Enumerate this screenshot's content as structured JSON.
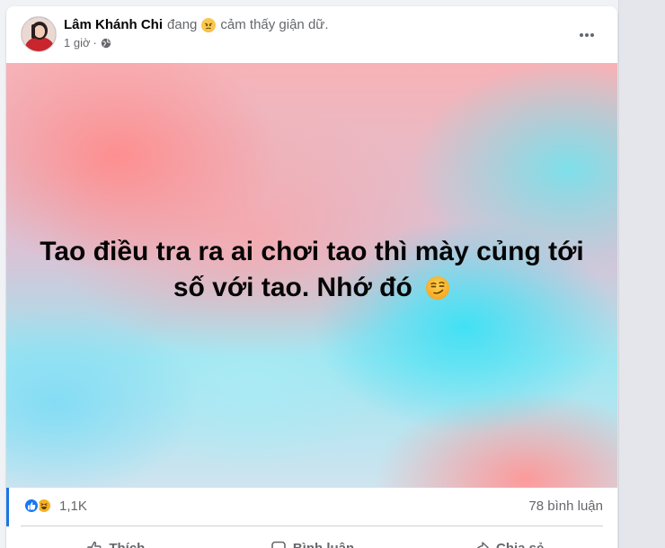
{
  "post": {
    "author_name": "Lâm Khánh Chi",
    "feeling_prefix": "đang",
    "feeling_emoji": "angry-face-icon",
    "feeling_text": "cảm thấy giận dữ.",
    "time": "1 giờ",
    "separator": "·",
    "privacy_icon": "globe-icon",
    "body_lines": [
      "Tao điều tra ra ai chơi tao thì mày củng tới",
      "số với tao. Nhớ đó"
    ],
    "body_emoji": "smirking-face-icon"
  },
  "stats": {
    "reaction_icons": [
      "like-icon",
      "haha-icon"
    ],
    "reaction_count": "1,1K",
    "comment_count": "78 bình luận"
  },
  "actions": {
    "like_label": "Thích",
    "comment_label": "Bình luận",
    "share_label": "Chia sẻ"
  },
  "colors": {
    "accent": "#1877f2",
    "text_primary": "#050505",
    "text_secondary": "#65676b",
    "page_background": "#f0f2f5"
  }
}
